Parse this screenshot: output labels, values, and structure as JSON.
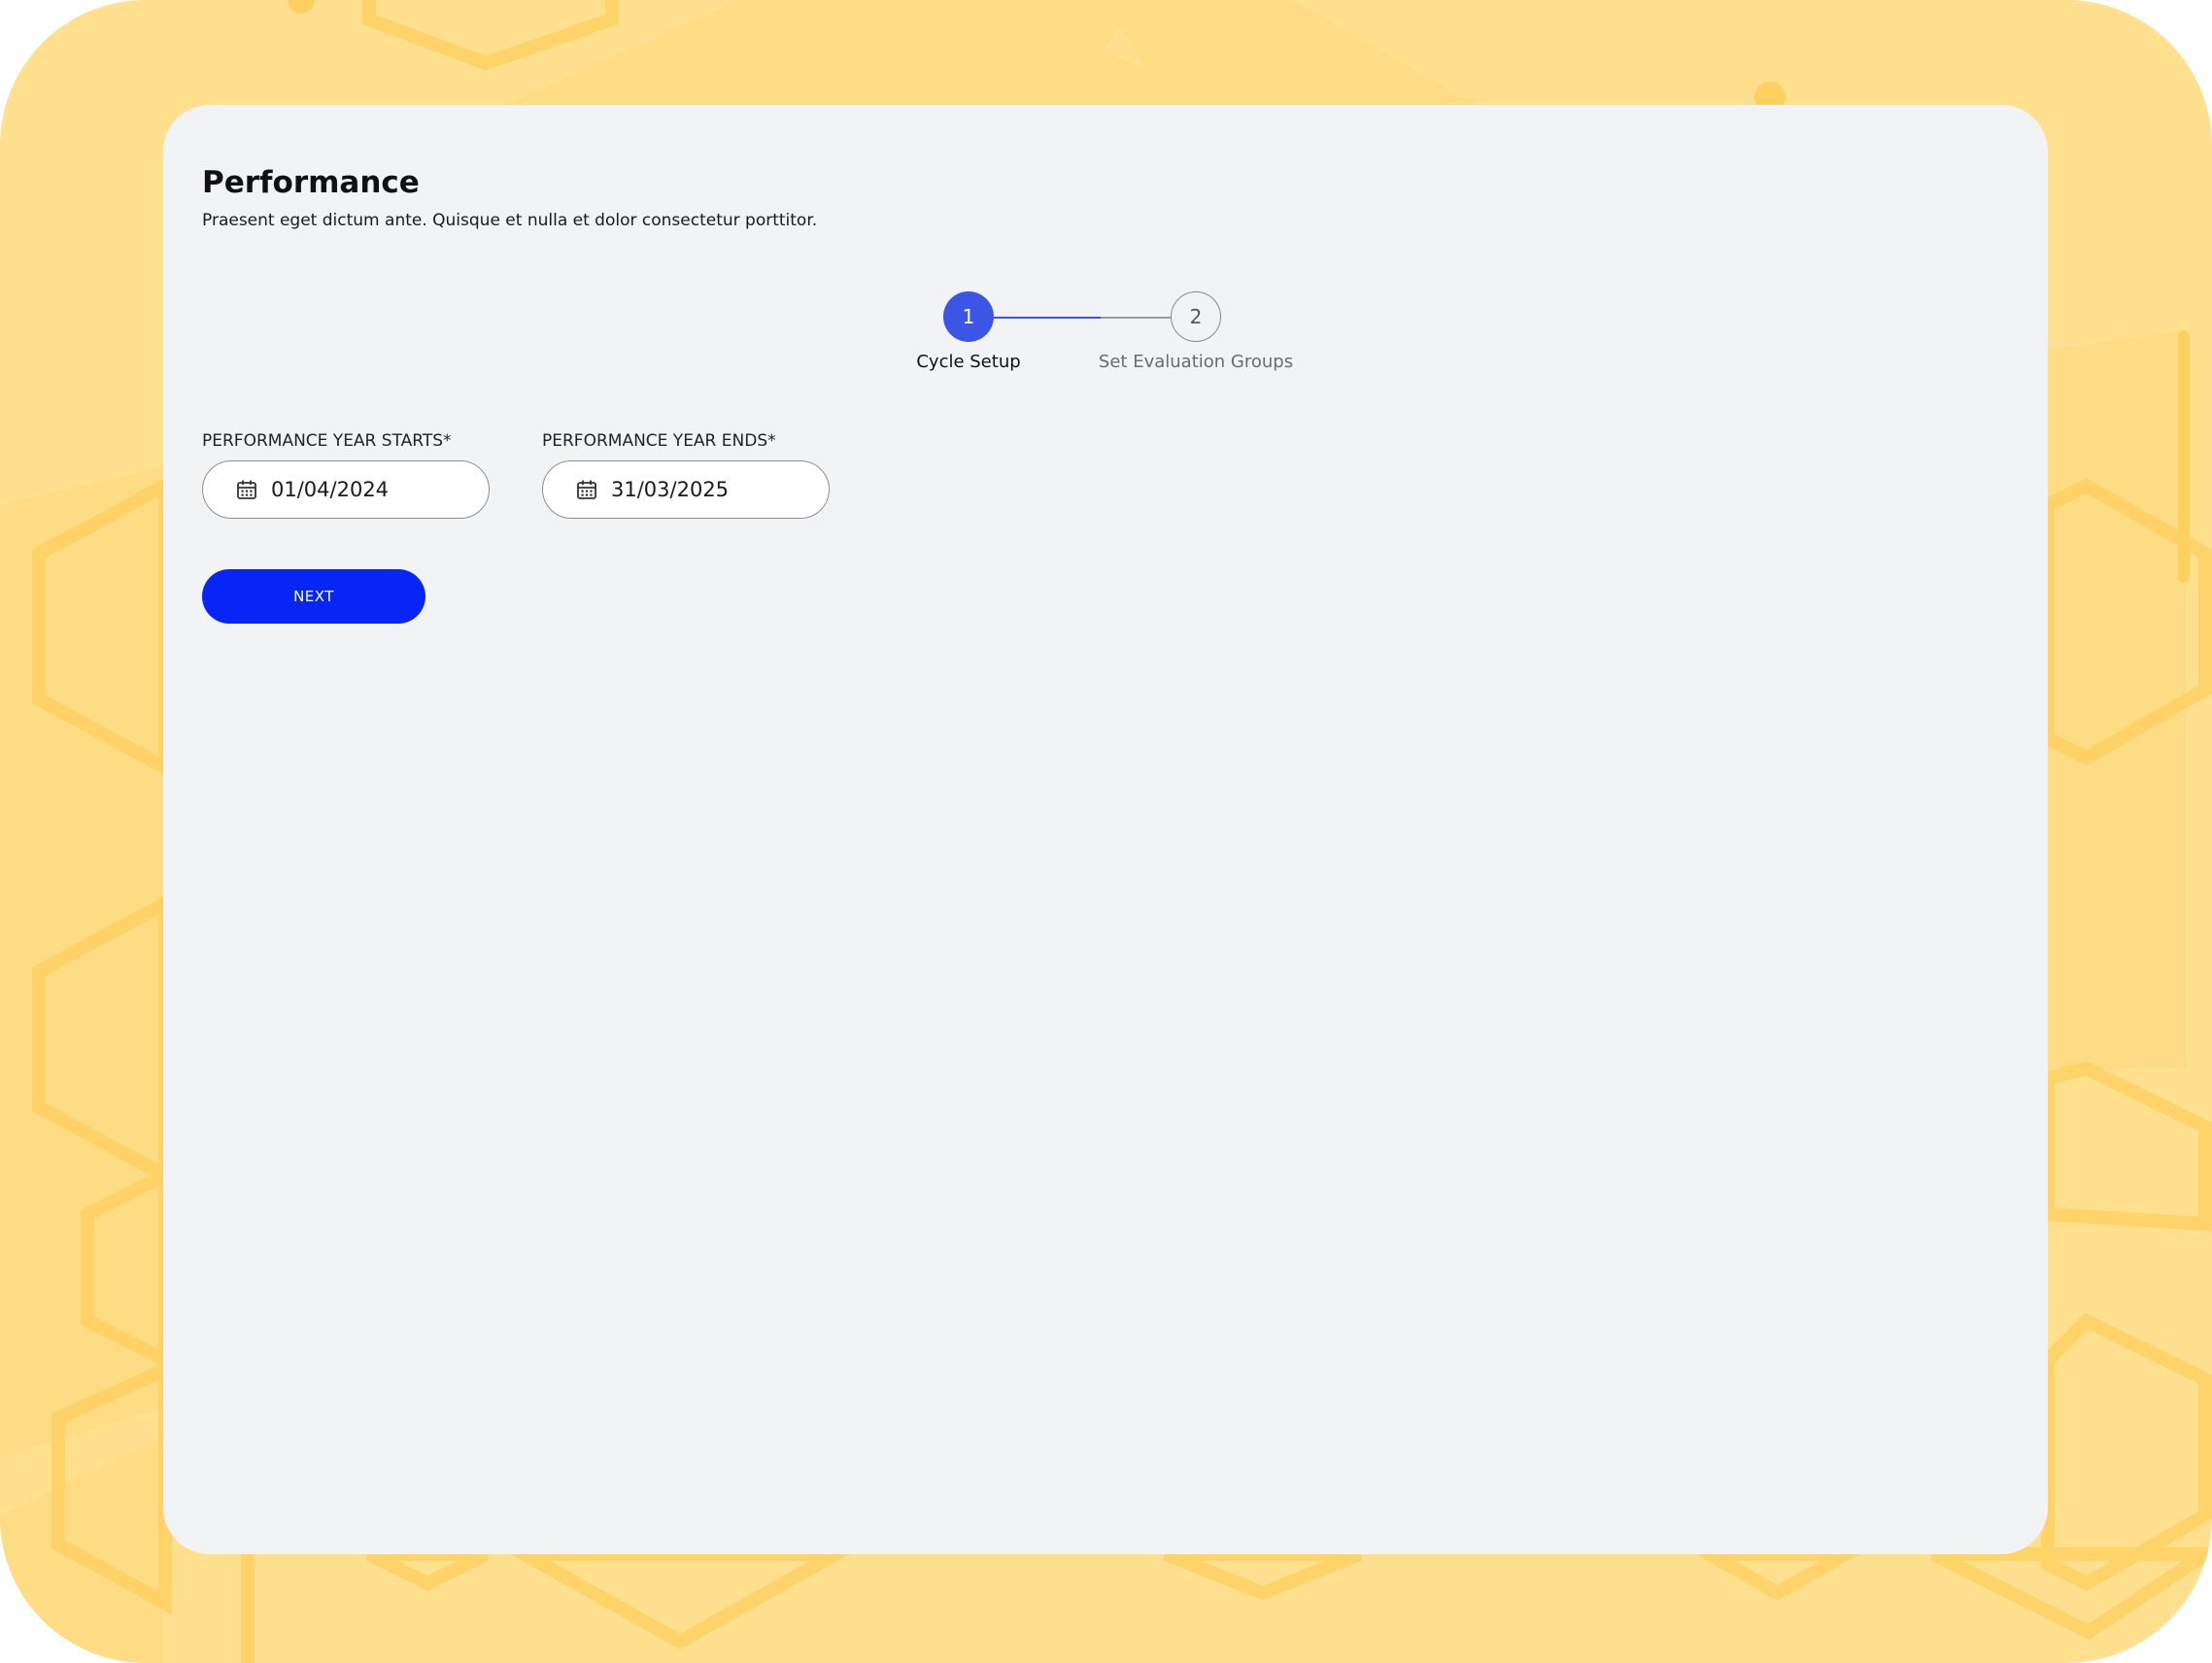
{
  "page": {
    "title": "Performance",
    "subtitle": "Praesent eget dictum ante. Quisque et nulla et dolor consectetur porttitor."
  },
  "stepper": {
    "steps": [
      {
        "number": "1",
        "label": "Cycle Setup",
        "state": "active"
      },
      {
        "number": "2",
        "label": "Set Evaluation Groups",
        "state": "upcoming"
      }
    ]
  },
  "form": {
    "start": {
      "label": "PERFORMANCE YEAR STARTS*",
      "value": "01/04/2024",
      "icon": "calendar-icon"
    },
    "end": {
      "label": "PERFORMANCE YEAR ENDS*",
      "value": "31/03/2025",
      "icon": "calendar-icon"
    }
  },
  "actions": {
    "next_label": "NEXT"
  },
  "colors": {
    "background": "#fee08f",
    "card": "#f2f3f5",
    "step_active": "#3b55e6",
    "primary_button": "#0726f5"
  }
}
